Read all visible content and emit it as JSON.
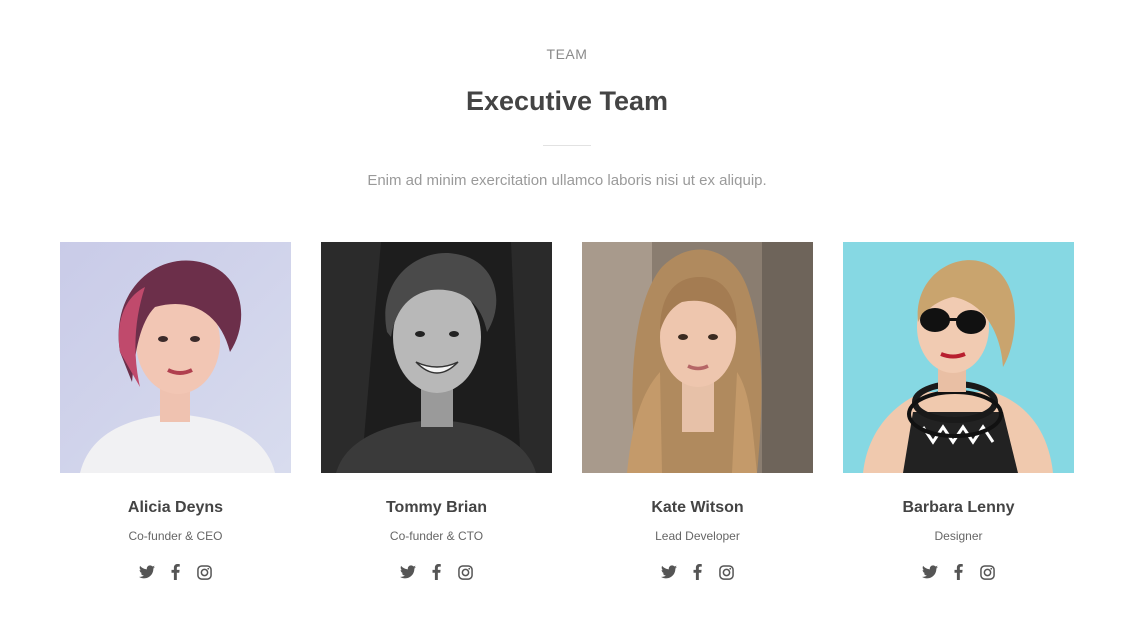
{
  "header": {
    "eyebrow": "TEAM",
    "title": "Executive Team",
    "subtitle": "Enim ad minim exercitation ullamco laboris nisi ut ex aliquip."
  },
  "members": [
    {
      "name": "Alicia Deyns",
      "role": "Co-funder & CEO"
    },
    {
      "name": "Tommy Brian",
      "role": "Co-funder & CTO"
    },
    {
      "name": "Kate Witson",
      "role": "Lead Developer"
    },
    {
      "name": "Barbara Lenny",
      "role": "Designer"
    }
  ],
  "social_icons": [
    "twitter-icon",
    "facebook-icon",
    "instagram-icon"
  ],
  "colors": {
    "heading": "#444444",
    "muted": "#9a9a9a",
    "icon": "#555555",
    "divider": "#e2e2e2"
  }
}
